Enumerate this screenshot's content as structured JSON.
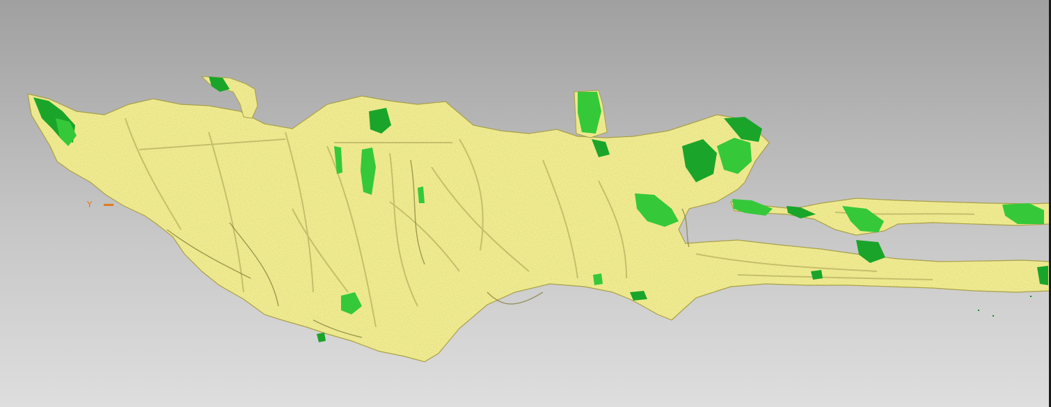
{
  "viewport": {
    "axis_label": "Y",
    "colors": {
      "background_top": "#a0a0a0",
      "background_bottom": "#dedede",
      "surface": "#f3ee92",
      "surface_shadow": "#b8b162",
      "deviation_light": "#35c93a",
      "deviation_dark": "#0f8a1f",
      "axis": "#e07a1f"
    }
  }
}
